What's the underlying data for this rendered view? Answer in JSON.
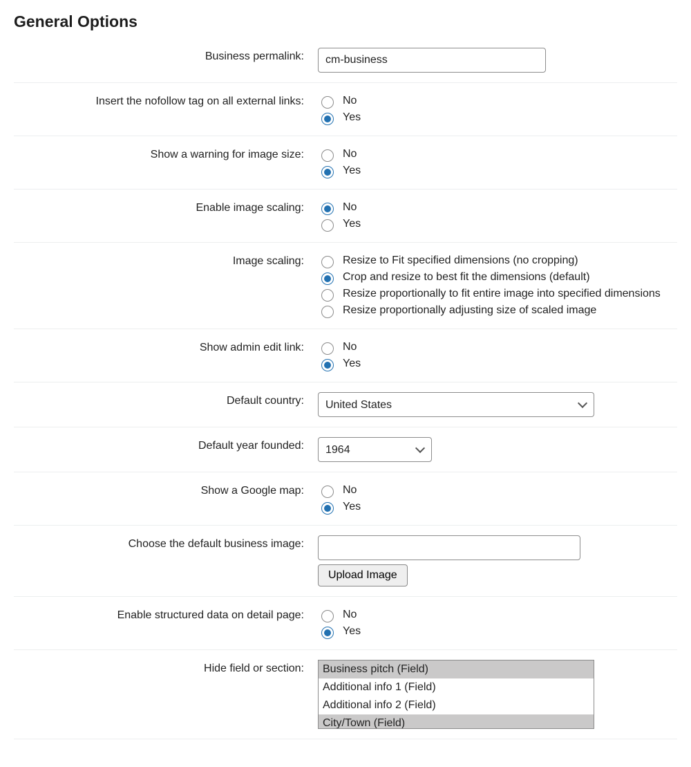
{
  "section_title": "General Options",
  "labels": {
    "permalink": "Business permalink:",
    "nofollow": "Insert the nofollow tag on all external links:",
    "image_size_warning": "Show a warning for image size:",
    "enable_scaling": "Enable image scaling:",
    "image_scaling": "Image scaling:",
    "admin_edit": "Show admin edit link:",
    "default_country": "Default country:",
    "default_year": "Default year founded:",
    "google_map": "Show a Google map:",
    "default_image": "Choose the default business image:",
    "structured_data": "Enable structured data on detail page:",
    "hide_field": "Hide field or section:"
  },
  "values": {
    "permalink": "cm-business",
    "default_country": "United States",
    "default_year": "1964",
    "default_image": ""
  },
  "radio": {
    "no": "No",
    "yes": "Yes"
  },
  "scaling_options": {
    "fit": "Resize to Fit specified dimensions (no cropping)",
    "crop": "Crop and resize to best fit the dimensions (default)",
    "prop_fit": "Resize proportionally to fit entire image into specified dimensions",
    "prop_adj": "Resize proportionally adjusting size of scaled image"
  },
  "buttons": {
    "upload_image": "Upload Image"
  },
  "hide_options": {
    "business_pitch": "Business pitch (Field)",
    "addl_info_1": "Additional info 1 (Field)",
    "addl_info_2": "Additional info 2 (Field)",
    "city_town": "City/Town (Field)"
  }
}
